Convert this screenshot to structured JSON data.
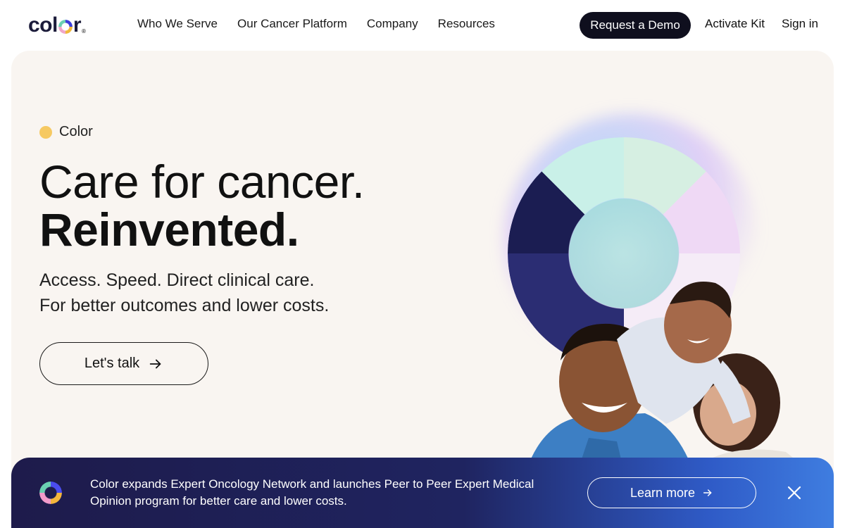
{
  "brand": {
    "logo_text_a": "col",
    "logo_text_b": "r"
  },
  "nav": {
    "items": [
      {
        "label": "Who We Serve"
      },
      {
        "label": "Our Cancer Platform"
      },
      {
        "label": "Company"
      },
      {
        "label": "Resources"
      }
    ],
    "demo_label": "Request a Demo",
    "activate_label": "Activate Kit",
    "signin_label": "Sign in"
  },
  "hero": {
    "eyebrow": "Color",
    "headline_light": "Care for cancer.",
    "headline_bold": "Reinvented.",
    "subline_1": "Access. Speed. Direct clinical care.",
    "subline_2": "For better outcomes and lower costs.",
    "cta_label": "Let's talk"
  },
  "banner": {
    "text_line_1": "Color expands Expert Oncology Network and launches Peer to Peer Expert Medical",
    "text_line_2": "Opinion program for better care and lower costs.",
    "cta_label": "Learn more"
  },
  "colors": {
    "accent_yellow": "#f6c962",
    "hero_bg": "#f9f5f1",
    "banner_dark": "#1e1b4b",
    "banner_light": "#3f7de0",
    "button_dark": "#0f0f1e"
  },
  "icons": [
    "color-logo-icon",
    "arrow-right-icon",
    "close-icon",
    "color-ring-icon"
  ]
}
